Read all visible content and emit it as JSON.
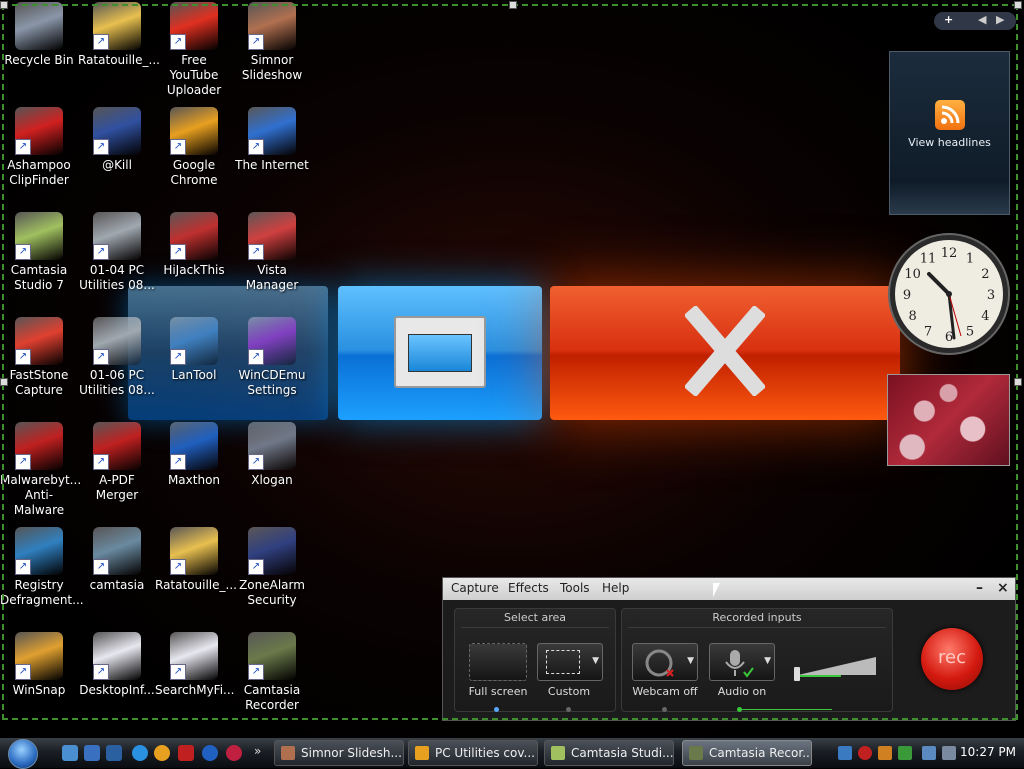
{
  "desktop_icons": [
    {
      "label": "Recycle Bin",
      "icon": "recycle-bin-icon",
      "color": "#8a96a8"
    },
    {
      "label": "Ratatouille_...",
      "icon": "zip-folder-icon",
      "color": "#e8c050"
    },
    {
      "label": "Free YouTube Uploader",
      "icon": "rocket-icon",
      "color": "#e03020"
    },
    {
      "label": "Simnor Slideshow",
      "icon": "slideshow-icon",
      "color": "#b07050"
    },
    {
      "label": "Ashampoo ClipFinder",
      "icon": "clapperboard-icon",
      "color": "#d02020"
    },
    {
      "label": "@Kill",
      "icon": "kill-process-icon",
      "color": "#3050a0"
    },
    {
      "label": "Google Chrome",
      "icon": "chrome-icon",
      "color": "#e8a020"
    },
    {
      "label": "The Internet",
      "icon": "network-globe-icon",
      "color": "#3070d0"
    },
    {
      "label": "Camtasia Studio 7",
      "icon": "camtasia-studio-icon",
      "color": "#a0c060"
    },
    {
      "label": "01-04 PC Utilities 08...",
      "icon": "disc-drive-icon",
      "color": "#a0a8b0"
    },
    {
      "label": "HiJackThis",
      "icon": "hijackthis-icon",
      "color": "#c03030"
    },
    {
      "label": "Vista Manager",
      "icon": "tools-icon",
      "color": "#d04040"
    },
    {
      "label": "FastStone Capture",
      "icon": "capture-icon",
      "color": "#e04030"
    },
    {
      "label": "01-06 PC Utilities 08...",
      "icon": "disc-drive-icon",
      "color": "#a0a8b0"
    },
    {
      "label": "LanTool",
      "icon": "lantool-icon",
      "color": "#4080c0"
    },
    {
      "label": "WinCDEmu Settings",
      "icon": "cd-emu-icon",
      "color": "#8040c0"
    },
    {
      "label": "Malwarebyt... Anti-Malware",
      "icon": "malwarebytes-icon",
      "color": "#c02020"
    },
    {
      "label": "A-PDF Merger",
      "icon": "pdf-icon",
      "color": "#c02020"
    },
    {
      "label": "Maxthon",
      "icon": "maxthon-icon",
      "color": "#2060c0"
    },
    {
      "label": "Xlogan",
      "icon": "xlogan-icon",
      "color": "#707888"
    },
    {
      "label": "Registry Defragment...",
      "icon": "registry-icon",
      "color": "#3080c0"
    },
    {
      "label": "camtasia",
      "icon": "installer-icon",
      "color": "#6a8aa0"
    },
    {
      "label": "Ratatouille_...",
      "icon": "zip-folder-icon",
      "color": "#e8c050"
    },
    {
      "label": "ZoneAlarm Security",
      "icon": "zonealarm-icon",
      "color": "#304080"
    },
    {
      "label": "WinSnap",
      "icon": "winsnap-icon",
      "color": "#e0a030"
    },
    {
      "label": "DesktopInf...",
      "icon": "document-icon",
      "color": "#e8e8f0"
    },
    {
      "label": "SearchMyFi...",
      "icon": "document-icon",
      "color": "#e8e8f0"
    },
    {
      "label": "Camtasia Recorder",
      "icon": "camcorder-icon",
      "color": "#6a7a4a"
    }
  ],
  "gadgets": {
    "sidebar_add": "+",
    "feed_label": "View headlines",
    "clock_numbers": [
      "12",
      "1",
      "2",
      "3",
      "4",
      "5",
      "6",
      "7",
      "8",
      "9",
      "10",
      "11"
    ]
  },
  "recorder": {
    "menu": [
      "Capture",
      "Effects",
      "Tools",
      "Help"
    ],
    "minimize": "–",
    "close": "×",
    "select_area_title": "Select area",
    "full_screen_label": "Full screen",
    "custom_label": "Custom",
    "recorded_inputs_title": "Recorded inputs",
    "webcam_label": "Webcam off",
    "audio_label": "Audio on",
    "rec_label": "rec",
    "audio_level": 0.55
  },
  "taskbar": {
    "tasks": [
      {
        "label": "Simnor Slidesh...",
        "color": "#b07050",
        "active": false
      },
      {
        "label": "PC Utilities cov...",
        "color": "#e8a020",
        "active": false
      },
      {
        "label": "Camtasia Studi...",
        "color": "#a0c060",
        "active": false
      },
      {
        "label": "Camtasia Recor...",
        "color": "#6a7a4a",
        "active": true
      }
    ],
    "clock": "10:27 PM"
  }
}
